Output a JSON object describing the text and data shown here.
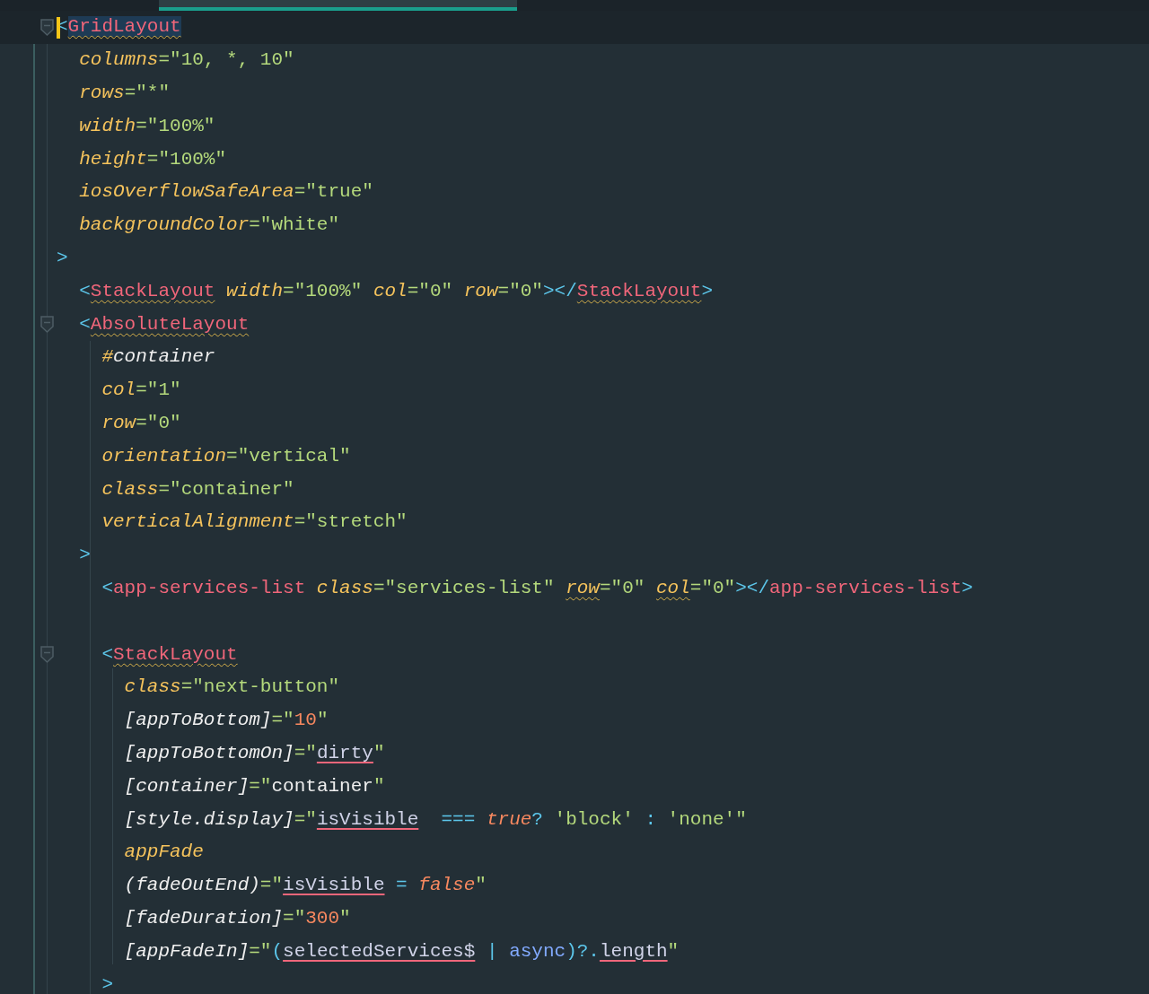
{
  "editor": {
    "lines": [
      {
        "current": true,
        "fold": true,
        "tokens": [
          {
            "kind": "punct",
            "t": "<"
          },
          {
            "kind": "tag-squiggle",
            "t": "GridLayout",
            "selected": true
          }
        ]
      },
      {
        "current": false,
        "fold": false,
        "tokens": [
          {
            "kind": "attr",
            "t": "  columns"
          },
          {
            "kind": "str",
            "t": "=\"10, *, 10\""
          }
        ]
      },
      {
        "current": false,
        "fold": false,
        "tokens": [
          {
            "kind": "attr",
            "t": "  rows"
          },
          {
            "kind": "str",
            "t": "=\"*\""
          }
        ]
      },
      {
        "current": false,
        "fold": false,
        "tokens": [
          {
            "kind": "attr",
            "t": "  width"
          },
          {
            "kind": "str",
            "t": "=\"100%\""
          }
        ]
      },
      {
        "current": false,
        "fold": false,
        "tokens": [
          {
            "kind": "attr",
            "t": "  height"
          },
          {
            "kind": "str",
            "t": "=\"100%\""
          }
        ]
      },
      {
        "current": false,
        "fold": false,
        "tokens": [
          {
            "kind": "attr",
            "t": "  iosOverflowSafeArea"
          },
          {
            "kind": "str",
            "t": "=\"true\""
          }
        ]
      },
      {
        "current": false,
        "fold": false,
        "tokens": [
          {
            "kind": "attr",
            "t": "  backgroundColor"
          },
          {
            "kind": "str",
            "t": "=\"white\""
          }
        ]
      },
      {
        "current": false,
        "fold": false,
        "tokens": [
          {
            "kind": "punct",
            "t": ">"
          }
        ]
      },
      {
        "current": false,
        "fold": false,
        "tokens": [
          {
            "kind": "punct",
            "t": "  <"
          },
          {
            "kind": "tag-squiggle",
            "t": "StackLayout"
          },
          {
            "kind": "attr",
            "t": " width"
          },
          {
            "kind": "str",
            "t": "=\"100%\""
          },
          {
            "kind": "attr",
            "t": " col"
          },
          {
            "kind": "str",
            "t": "=\"0\""
          },
          {
            "kind": "attr",
            "t": " row"
          },
          {
            "kind": "str",
            "t": "=\"0\""
          },
          {
            "kind": "punct",
            "t": "></"
          },
          {
            "kind": "tag-squiggle",
            "t": "StackLayout"
          },
          {
            "kind": "punct",
            "t": ">"
          }
        ]
      },
      {
        "current": false,
        "fold": true,
        "tokens": [
          {
            "kind": "punct",
            "t": "  <"
          },
          {
            "kind": "tag-squiggle",
            "t": "AbsoluteLayout"
          }
        ]
      },
      {
        "current": false,
        "fold": false,
        "tokens": [
          {
            "kind": "attr",
            "t": "    #"
          },
          {
            "kind": "bind",
            "t": "container"
          }
        ]
      },
      {
        "current": false,
        "fold": false,
        "tokens": [
          {
            "kind": "attr",
            "t": "    col"
          },
          {
            "kind": "str",
            "t": "=\"1\""
          }
        ]
      },
      {
        "current": false,
        "fold": false,
        "tokens": [
          {
            "kind": "attr",
            "t": "    row"
          },
          {
            "kind": "str",
            "t": "=\"0\""
          }
        ]
      },
      {
        "current": false,
        "fold": false,
        "tokens": [
          {
            "kind": "attr",
            "t": "    orientation"
          },
          {
            "kind": "str",
            "t": "=\"vertical\""
          }
        ]
      },
      {
        "current": false,
        "fold": false,
        "tokens": [
          {
            "kind": "attr",
            "t": "    class"
          },
          {
            "kind": "str",
            "t": "=\"container\""
          }
        ]
      },
      {
        "current": false,
        "fold": false,
        "tokens": [
          {
            "kind": "attr",
            "t": "    verticalAlignment"
          },
          {
            "kind": "str",
            "t": "=\"stretch\""
          }
        ]
      },
      {
        "current": false,
        "fold": false,
        "tokens": [
          {
            "kind": "punct",
            "t": "  >"
          }
        ]
      },
      {
        "current": false,
        "fold": false,
        "tokens": [
          {
            "kind": "punct",
            "t": "    <"
          },
          {
            "kind": "tag",
            "t": "app-services-list"
          },
          {
            "kind": "attr",
            "t": " class"
          },
          {
            "kind": "str",
            "t": "=\"services-list\" "
          },
          {
            "kind": "attr-squiggle",
            "t": "row"
          },
          {
            "kind": "str",
            "t": "=\"0\" "
          },
          {
            "kind": "attr-squiggle",
            "t": "col"
          },
          {
            "kind": "str",
            "t": "=\"0\""
          },
          {
            "kind": "punct",
            "t": "></"
          },
          {
            "kind": "tag",
            "t": "app-services-list"
          },
          {
            "kind": "punct",
            "t": ">"
          }
        ]
      },
      {
        "current": false,
        "fold": false
      },
      {
        "current": false,
        "fold": true,
        "tokens": [
          {
            "kind": "punct",
            "t": "    <"
          },
          {
            "kind": "tag-squiggle",
            "t": "StackLayout"
          }
        ]
      },
      {
        "current": false,
        "fold": false,
        "tokens": [
          {
            "kind": "attr",
            "t": "      class"
          },
          {
            "kind": "str",
            "t": "=\"next-button\""
          }
        ]
      },
      {
        "current": false,
        "fold": false,
        "tokens": [
          {
            "kind": "bind",
            "t": "      [appToBottom]"
          },
          {
            "kind": "str",
            "t": "=\""
          },
          {
            "kind": "num",
            "t": "10"
          },
          {
            "kind": "str",
            "t": "\""
          }
        ]
      },
      {
        "current": false,
        "fold": false,
        "tokens": [
          {
            "kind": "bind",
            "t": "      [appToBottomOn]"
          },
          {
            "kind": "str",
            "t": "=\""
          },
          {
            "kind": "ref",
            "t": "dirty"
          },
          {
            "kind": "str",
            "t": "\""
          }
        ]
      },
      {
        "current": false,
        "fold": false,
        "tokens": [
          {
            "kind": "bind",
            "t": "      [container]"
          },
          {
            "kind": "str",
            "t": "=\""
          },
          {
            "kind": "plain",
            "t": "container"
          },
          {
            "kind": "str",
            "t": "\""
          }
        ]
      },
      {
        "current": false,
        "fold": false,
        "tokens": [
          {
            "kind": "bind",
            "t": "      [style.display]"
          },
          {
            "kind": "str",
            "t": "=\""
          },
          {
            "kind": "ref",
            "t": "isVisible"
          },
          {
            "kind": "op",
            "t": "  === "
          },
          {
            "kind": "kw",
            "t": "true"
          },
          {
            "kind": "op",
            "t": "? "
          },
          {
            "kind": "str",
            "t": "'block'"
          },
          {
            "kind": "op",
            "t": " : "
          },
          {
            "kind": "str",
            "t": "'none'\""
          }
        ]
      },
      {
        "current": false,
        "fold": false,
        "tokens": [
          {
            "kind": "attr",
            "t": "      appFade"
          }
        ]
      },
      {
        "current": false,
        "fold": false,
        "tokens": [
          {
            "kind": "bind",
            "t": "      (fadeOutEnd)"
          },
          {
            "kind": "str",
            "t": "=\""
          },
          {
            "kind": "ref",
            "t": "isVisible"
          },
          {
            "kind": "op",
            "t": " = "
          },
          {
            "kind": "kw",
            "t": "false"
          },
          {
            "kind": "str",
            "t": "\""
          }
        ]
      },
      {
        "current": false,
        "fold": false,
        "tokens": [
          {
            "kind": "bind",
            "t": "      [fadeDuration]"
          },
          {
            "kind": "str",
            "t": "=\""
          },
          {
            "kind": "num",
            "t": "300"
          },
          {
            "kind": "str",
            "t": "\""
          }
        ]
      },
      {
        "current": false,
        "fold": false,
        "tokens": [
          {
            "kind": "bind",
            "t": "      [appFadeIn]"
          },
          {
            "kind": "str",
            "t": "=\""
          },
          {
            "kind": "op",
            "t": "("
          },
          {
            "kind": "ref",
            "t": "selectedServices$"
          },
          {
            "kind": "op",
            "t": " | "
          },
          {
            "kind": "fn",
            "t": "async"
          },
          {
            "kind": "op",
            "t": ")?."
          },
          {
            "kind": "ref",
            "t": "length"
          },
          {
            "kind": "str",
            "t": "\""
          }
        ]
      },
      {
        "current": false,
        "fold": false,
        "tokens": [
          {
            "kind": "punct",
            "t": "    >"
          }
        ]
      }
    ]
  }
}
